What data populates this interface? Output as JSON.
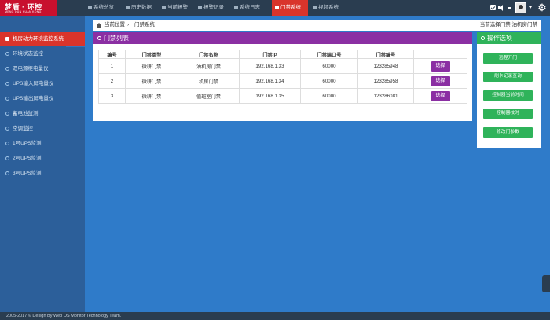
{
  "brand": {
    "name": "梦盾 · 环控",
    "subtitle": "MENG DUN HUAN KONG"
  },
  "nav": [
    {
      "label": "系统总览",
      "icon": "home-icon"
    },
    {
      "label": "历史数据",
      "icon": "clock-icon"
    },
    {
      "label": "当前报警",
      "icon": "alarm-icon"
    },
    {
      "label": "报警记录",
      "icon": "list-icon"
    },
    {
      "label": "系统日志",
      "icon": "log-icon"
    },
    {
      "label": "门禁系统",
      "icon": "door-icon",
      "active": true
    },
    {
      "label": "视频系统",
      "icon": "camera-icon"
    }
  ],
  "sidebar": [
    {
      "label": "机房动力环境监控系统",
      "active": true
    },
    {
      "label": "环境状态监控"
    },
    {
      "label": "双电源柜电量仪"
    },
    {
      "label": "UPS输入屏电量仪"
    },
    {
      "label": "UPS输出屏电量仪"
    },
    {
      "label": "蓄电池监测"
    },
    {
      "label": "空调监控"
    },
    {
      "label": "1号UPS监测"
    },
    {
      "label": "2号UPS监测"
    },
    {
      "label": "3号UPS监测"
    }
  ],
  "breadcrumb": {
    "home": "当前位置",
    "sep": "›",
    "page": "门禁系统",
    "current": "当前选择门禁 油机房门禁"
  },
  "list_panel": {
    "title": "门禁列表"
  },
  "table": {
    "headers": [
      "编号",
      "门禁类型",
      "门禁名称",
      "门禁IP",
      "门禁端口号",
      "门禁编号",
      ""
    ],
    "rows": [
      [
        "1",
        "微耕门禁",
        "油机房门禁",
        "192.168.1.33",
        "60000",
        "123285948",
        "选择"
      ],
      [
        "2",
        "微耕门禁",
        "机房门禁",
        "192.168.1.34",
        "60000",
        "123285958",
        "选择"
      ],
      [
        "3",
        "微耕门禁",
        "值班室门禁",
        "192.168.1.35",
        "60000",
        "123286081",
        "选择"
      ]
    ]
  },
  "ops_panel": {
    "title": "操作选项",
    "buttons": [
      "远程开门",
      "刷卡记录查询",
      "控制器当前时间",
      "控制器校时",
      "修改门参数"
    ]
  },
  "footer": "2005-2017 © Design By Web OS Monitor Technology Team.",
  "colors": {
    "topbar": "#2a3d50",
    "accent_red": "#d9342b",
    "purple": "#8b2fa3",
    "green": "#2fb35a",
    "main_bg": "#2f7bc9"
  }
}
